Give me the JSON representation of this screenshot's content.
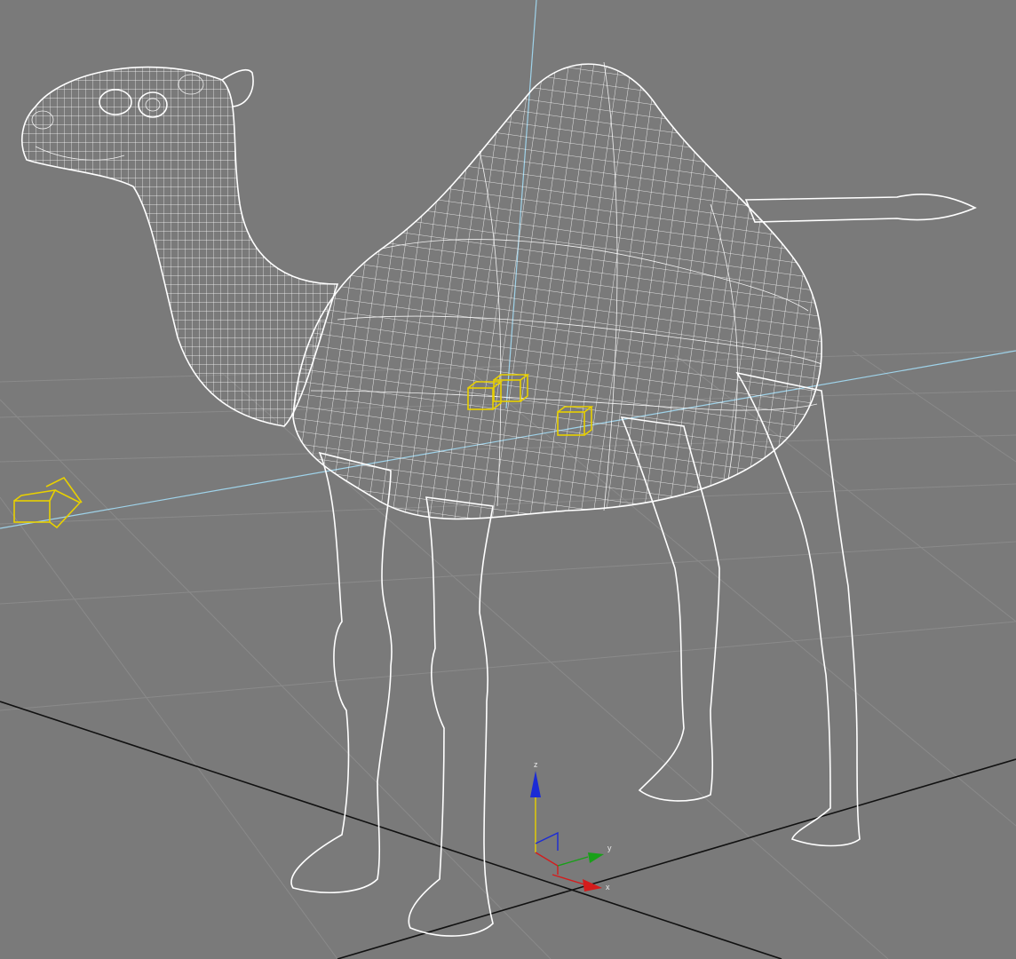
{
  "viewport": {
    "background": "#7a7a7a",
    "grid_color": "#8a8a8a",
    "axis_color": "#9fd3ea",
    "wireframe_color": "#ffffff",
    "helper_color": "#e8d000"
  },
  "gizmo": {
    "z_label": "z",
    "y_label": "y",
    "x_label": "x",
    "z_color": "#1b2bd6",
    "y_color": "#18a018",
    "x_color": "#d41c1c"
  }
}
